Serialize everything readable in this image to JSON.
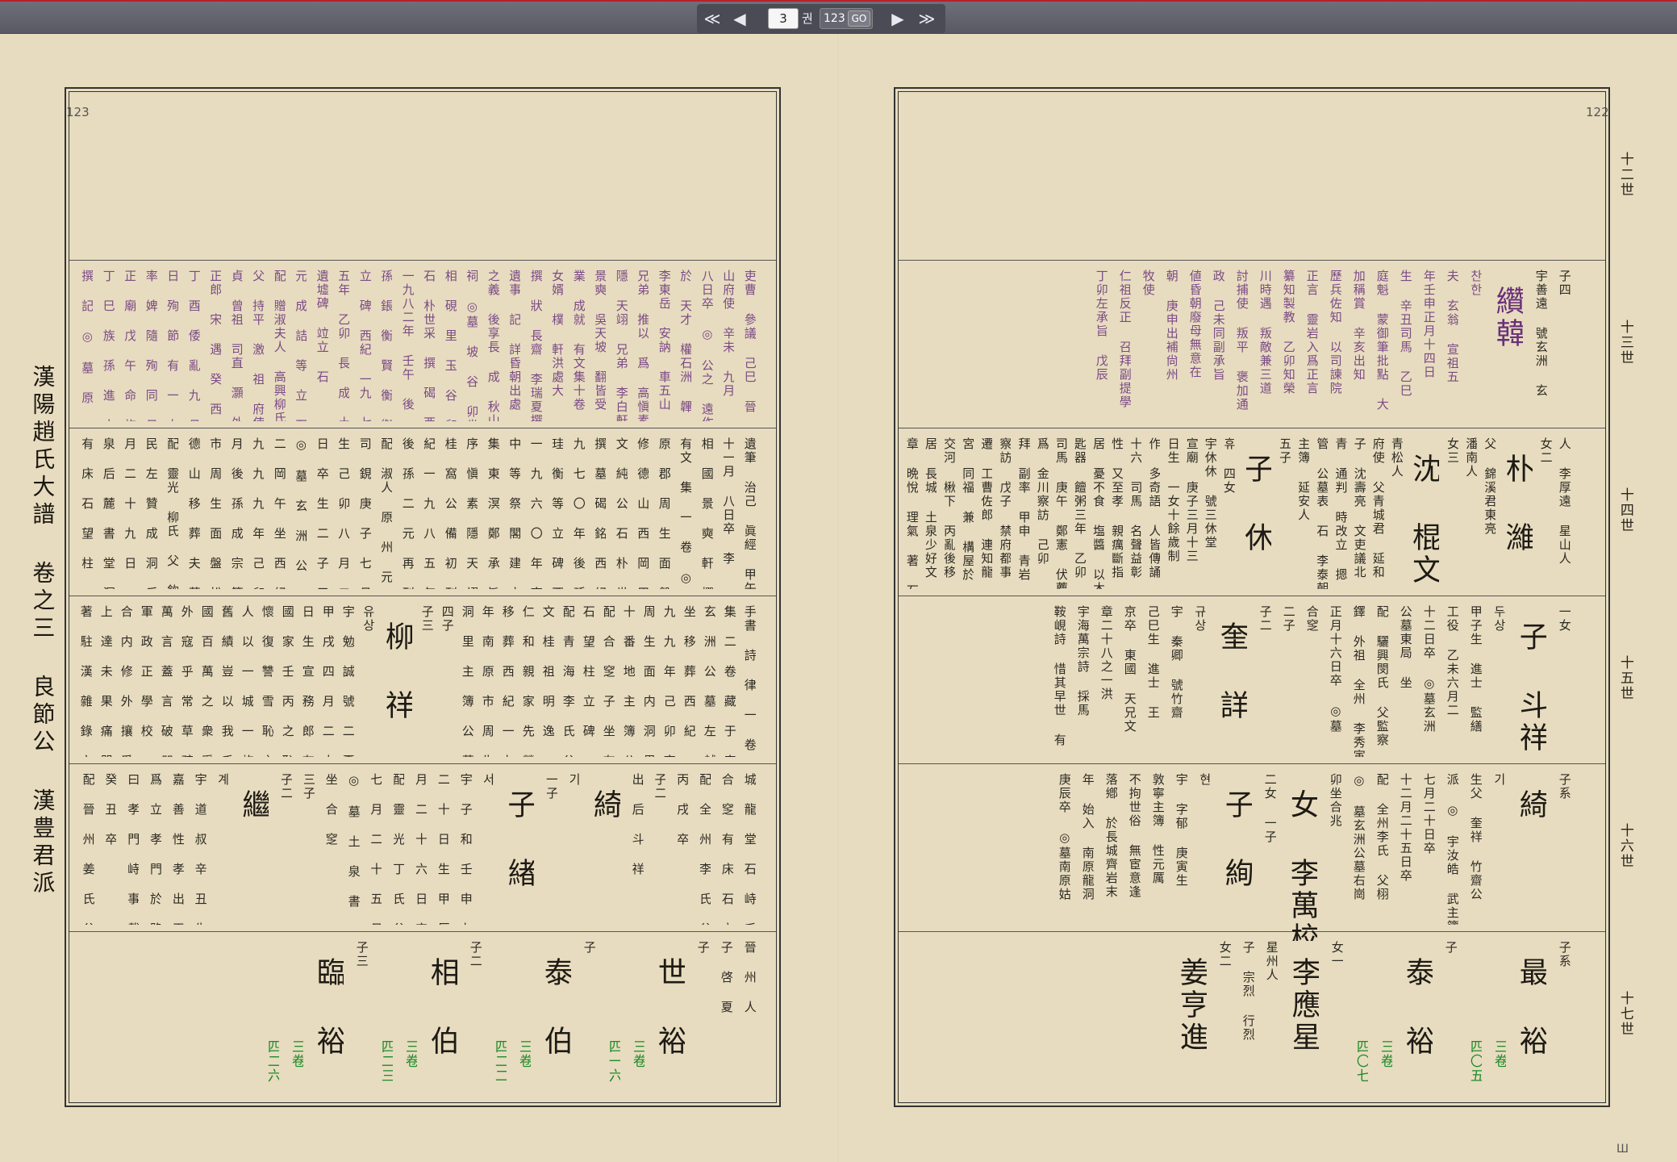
{
  "toolbar": {
    "first": "≪",
    "prev": "◀",
    "page": "3",
    "page_unit": "권",
    "total": "123",
    "go": "GO",
    "next": "▶",
    "last": "≫"
  },
  "pages": {
    "left_number": "123",
    "right_number": "122"
  },
  "book_title": "漢陽趙氏大譜 卷之三 良節公 漢豊君派",
  "generations": [
    "十二世",
    "十三世",
    "十四世",
    "十五世",
    "十六世",
    "十七世"
  ],
  "right_page": {
    "r13": [
      {
        "type": "s",
        "text": "子四"
      },
      {
        "type": "s",
        "text": "宇善遠 號玄洲 玄"
      },
      {
        "type": "bigp",
        "text": "纘韓"
      },
      {
        "type": "p",
        "text": "찬한"
      },
      {
        "type": "p",
        "text": "夫 玄翁 宣祖五"
      },
      {
        "type": "p",
        "text": "年壬申正月十四日"
      },
      {
        "type": "p",
        "text": "生 辛丑司馬 乙巳"
      },
      {
        "type": "p",
        "text": "庭魁 蒙御筆批點 大"
      },
      {
        "type": "p",
        "text": "加稱賞 辛亥出知"
      },
      {
        "type": "p",
        "text": "歷兵佐知 以司諫院"
      },
      {
        "type": "p",
        "text": "正言 靈岩入爲正言"
      },
      {
        "type": "p",
        "text": "纂知製教 乙卯知榮"
      },
      {
        "type": "p",
        "text": "川時遇 叛敵兼三道"
      },
      {
        "type": "p",
        "text": "討捕使 叛平 褒加通"
      },
      {
        "type": "p",
        "text": "政 己未同副承旨"
      },
      {
        "type": "p",
        "text": "値昏朝廢母無意在"
      },
      {
        "type": "p",
        "text": "朝 庚申出補尙州"
      },
      {
        "type": "p",
        "text": "牧使"
      },
      {
        "type": "p",
        "text": "仁祖反正 召拜副提學"
      },
      {
        "type": "p",
        "text": "丁卯左承旨 戊辰"
      }
    ],
    "r14": [
      {
        "type": "s",
        "text": "人 李厚遠 星山人"
      },
      {
        "type": "s",
        "text": "女二"
      },
      {
        "type": "big",
        "text": "朴 濰"
      },
      {
        "type": "s",
        "text": "父 錦溪君東亮"
      },
      {
        "type": "s",
        "text": "潘南人"
      },
      {
        "type": "s",
        "text": "女三"
      },
      {
        "type": "big",
        "text": "沈 棍文"
      },
      {
        "type": "s",
        "text": "青松人"
      },
      {
        "type": "s",
        "text": "府使 父青城君 延和"
      },
      {
        "type": "s",
        "text": "子 沈壽亮 文吏議北"
      },
      {
        "type": "s",
        "text": "青 通判 時改立 摁"
      },
      {
        "type": "s",
        "text": "管 公墓表 石 李泰朝"
      },
      {
        "type": "s",
        "text": "主簿 延安人"
      },
      {
        "type": "s",
        "text": "五子"
      },
      {
        "type": "big",
        "text": "子 休"
      },
      {
        "type": "s",
        "text": "휴 四女"
      },
      {
        "type": "s",
        "text": "宇休休 號三休堂"
      },
      {
        "type": "s",
        "text": "宣廟 庚子三月十三"
      },
      {
        "type": "s",
        "text": "日生 一女十餘歲制"
      },
      {
        "type": "s",
        "text": "作 多奇語 人皆傳誦"
      },
      {
        "type": "s",
        "text": "十六 司馬 名聲益彰"
      },
      {
        "type": "s",
        "text": "性 又至孝 親癘斷指"
      },
      {
        "type": "s",
        "text": "居 憂不食 塩醬 以木"
      },
      {
        "type": "s",
        "text": "匙器 饘粥三年 乙卯"
      },
      {
        "type": "s",
        "text": "司馬 庚午 鄭憲 伏薦"
      },
      {
        "type": "s",
        "text": "爲 金川察訪 己卯"
      },
      {
        "type": "s",
        "text": "拜 副率 甲申 青岩"
      },
      {
        "type": "s",
        "text": "察訪 戊子 禁府都事"
      },
      {
        "type": "s",
        "text": "遷 工曹佐郎 連知龍"
      },
      {
        "type": "s",
        "text": "宮 同福 兼 構屋於"
      },
      {
        "type": "s",
        "text": "交河 楸下 丙亂後移"
      },
      {
        "type": "s",
        "text": "居 長城 土泉少好文"
      },
      {
        "type": "s",
        "text": "章 晩悅 理氣 著 石硼"
      }
    ],
    "r15": [
      {
        "type": "s",
        "text": "一女"
      },
      {
        "type": "big",
        "text": "子 斗祥"
      },
      {
        "type": "s",
        "text": "두상"
      },
      {
        "type": "s",
        "text": "甲子生 進士 監繕"
      },
      {
        "type": "s",
        "text": "工役 乙未六月二"
      },
      {
        "type": "s",
        "text": "十二日卒 ◎墓玄洲"
      },
      {
        "type": "s",
        "text": "公墓東局 坐"
      },
      {
        "type": "s",
        "text": "配 驪興閔氏 父監察"
      },
      {
        "type": "s",
        "text": "鐸 外祖 全州 李秀寅"
      },
      {
        "type": "s",
        "text": "正月十六日卒 ◎墓"
      },
      {
        "type": "s",
        "text": "合窆"
      },
      {
        "type": "s",
        "text": "二子"
      },
      {
        "type": "s",
        "text": "子二"
      },
      {
        "type": "big",
        "text": "奎 詳"
      },
      {
        "type": "s",
        "text": "규상"
      },
      {
        "type": "s",
        "text": "宇 秦卿 號竹齋"
      },
      {
        "type": "s",
        "text": "己巳生 進士 王"
      },
      {
        "type": "s",
        "text": "京卒 東國 天兄文"
      },
      {
        "type": "s",
        "text": "章二十八之一洪"
      },
      {
        "type": "s",
        "text": "宇海萬宗詩 採馬"
      },
      {
        "type": "s",
        "text": "鞍峴詩 惜其早世 有"
      }
    ],
    "r16": [
      {
        "type": "s",
        "text": "子系"
      },
      {
        "type": "big",
        "text": "綺"
      },
      {
        "type": "s",
        "text": "기"
      },
      {
        "type": "s",
        "text": "生父 奎祥 竹齋公"
      },
      {
        "type": "s",
        "text": "派 ◎ 宇汝皓 武主簿"
      },
      {
        "type": "s",
        "text": "七月二十日卒"
      },
      {
        "type": "s",
        "text": "十二月二十五日卒"
      },
      {
        "type": "s",
        "text": "配 全州李氏 父栩"
      },
      {
        "type": "s",
        "text": "◎ 墓玄洲公墓右崗"
      },
      {
        "type": "s",
        "text": "卯坐合兆"
      },
      {
        "type": "big",
        "text": "女 李萬校"
      },
      {
        "type": "s",
        "text": "二女 一子"
      },
      {
        "type": "big",
        "text": "子 絢"
      },
      {
        "type": "s",
        "text": "현"
      },
      {
        "type": "s",
        "text": "宇 字郁 庚寅生"
      },
      {
        "type": "s",
        "text": "敦寧主簿 性元厲"
      },
      {
        "type": "s",
        "text": "不拘世俗 無宦意逢"
      },
      {
        "type": "s",
        "text": "落鄕 於長城齊岩末"
      },
      {
        "type": "s",
        "text": "年 始入 南原龍洞"
      },
      {
        "type": "s",
        "text": "庚辰卒 ◎墓南原姑"
      }
    ],
    "r17": [
      {
        "type": "s",
        "text": "子系"
      },
      {
        "type": "big",
        "text": "最 裕"
      },
      {
        "type": "g",
        "text": "三卷"
      },
      {
        "type": "g",
        "text": "四〇五"
      },
      {
        "type": "s",
        "text": "子"
      },
      {
        "type": "big",
        "text": "泰 裕"
      },
      {
        "type": "g",
        "text": "三卷"
      },
      {
        "type": "g",
        "text": "四〇七"
      },
      {
        "type": "s",
        "text": "女一"
      },
      {
        "type": "big",
        "text": "李應星"
      },
      {
        "type": "s",
        "text": "星州人"
      },
      {
        "type": "s",
        "text": "子 宗烈 行烈"
      },
      {
        "type": "s",
        "text": "女二"
      },
      {
        "type": "big",
        "text": "姜亨進"
      }
    ]
  },
  "left_page": {
    "r13": [
      {
        "type": "p",
        "text": "吏曹 參議 己巳 晉"
      },
      {
        "type": "p",
        "text": "山府使 辛未 九月"
      },
      {
        "type": "p",
        "text": "八日卒 ◎ 公之 遠作"
      },
      {
        "type": "p",
        "text": "於 天才 權石洲 韠"
      },
      {
        "type": "p",
        "text": "李東岳 安訥 車五山"
      },
      {
        "type": "p",
        "text": "兄弟 推以 爲 高愼素"
      },
      {
        "type": "p",
        "text": "隱 天翊 兄弟 李白軒"
      },
      {
        "type": "p",
        "text": "景奭 吳天坡 翻皆受"
      },
      {
        "type": "p",
        "text": "業 成就 有文集十卷"
      },
      {
        "type": "p",
        "text": "女婿 樸 軒洪處大"
      },
      {
        "type": "p",
        "text": "撰 狀 長齋 李瑞夏撰"
      },
      {
        "type": "p",
        "text": "遺事 記 詳昏朝出處"
      },
      {
        "type": "p",
        "text": "之義 後享長 成 秋山"
      },
      {
        "type": "p",
        "text": "祠 ◎墓 坡 谷 卯坐 玄"
      },
      {
        "type": "p",
        "text": "相 硯 里 玉 谷 卯坐 玄"
      },
      {
        "type": "p",
        "text": "石 朴世采 撰 碣 西紀"
      },
      {
        "type": "p",
        "text": "一九八二年 壬午 後"
      },
      {
        "type": "p",
        "text": "孫 鋹 衡 賢 衡 衡 等"
      },
      {
        "type": "p",
        "text": "立 碑 西紀 一九 七"
      },
      {
        "type": "p",
        "text": "五年 乙卯 長 成 土 泉"
      },
      {
        "type": "p",
        "text": "遺墟碑 竝立 石"
      },
      {
        "type": "p",
        "text": "元 成 詰 等 立 石"
      },
      {
        "type": "p",
        "text": "配 贈淑夫人 高興柳氏"
      },
      {
        "type": "p",
        "text": "父 持平 激 祖 府使 忠"
      },
      {
        "type": "p",
        "text": "貞 曾祖 司直 灝 外祖"
      },
      {
        "type": "p",
        "text": "正郎 宋 遇 癸 西 生 値"
      },
      {
        "type": "p",
        "text": "丁 酉 倭 亂 九 月 二 十"
      },
      {
        "type": "p",
        "text": "日 殉 節 有 一 女 先 夭"
      },
      {
        "type": "p",
        "text": "率 婢 隨 殉 同 日 並 死"
      },
      {
        "type": "p",
        "text": "正 廟 戊 午 命 旌 後 五"
      },
      {
        "type": "p",
        "text": "丁 巳 族 孫 進 士 一 元"
      },
      {
        "type": "p",
        "text": "撰 記 ◎ 墓 原 州 多 侍"
      }
    ],
    "r14": [
      {
        "type": "s",
        "text": "遺筆 治己 眞經 甲午"
      },
      {
        "type": "s",
        "text": "十一月 八日卒 李"
      },
      {
        "type": "s",
        "text": "相 國 景 奭 軒 撰 行 狀"
      },
      {
        "type": "s",
        "text": "有文 集 一 卷 ◎ 墓 南"
      },
      {
        "type": "s",
        "text": "原 郡 周 生 面 盤 松 里"
      },
      {
        "type": "s",
        "text": "修 德 山 西 岡 甲 坐"
      },
      {
        "type": "s",
        "text": "文 純 公 石 朴 世 采"
      },
      {
        "type": "s",
        "text": "撰 墓 碣 銘 西 紀 一"
      },
      {
        "type": "s",
        "text": "九 七 〇 年 後 孫 南 原"
      },
      {
        "type": "s",
        "text": "珪 衡 等 立 碑 西 紀"
      },
      {
        "type": "s",
        "text": "一 九 六 〇 年 南 原 門"
      },
      {
        "type": "s",
        "text": "中 等 祭 閣 建 立 有 文"
      },
      {
        "type": "s",
        "text": "集 東 溟 鄭 承 旨 斗 卿"
      },
      {
        "type": "s",
        "text": "序 愼 素 隱 天 翊 跋 弟"
      },
      {
        "type": "s",
        "text": "桂 窩 公 備 初 刊 西"
      },
      {
        "type": "s",
        "text": "紀 一 九 八 五 年 乙 丑"
      },
      {
        "type": "s",
        "text": "後 孫 二 元 再 刊"
      },
      {
        "type": "s",
        "text": "配 淑人 原 州 元 氏 父 監"
      },
      {
        "type": "s",
        "text": "司 鋧 庚 子 七 月 八 日"
      },
      {
        "type": "s",
        "text": "生 己 卯 八 月 二 十 二"
      },
      {
        "type": "s",
        "text": "日 卒 生 二 子 三 女"
      },
      {
        "type": "s",
        "text": "◎ 墓 玄 洲 公 墓 北 越"
      },
      {
        "type": "s",
        "text": "二 岡 午 坐 西 紀 一"
      },
      {
        "type": "s",
        "text": "九 九 九 年 己 卯 十 一"
      },
      {
        "type": "s",
        "text": "月 後 孫 成 宗 等 南 原"
      },
      {
        "type": "s",
        "text": "市 周 生 面 盤 松 里 修"
      },
      {
        "type": "s",
        "text": "德 山 移 葬 夫 墓 合 定"
      },
      {
        "type": "s",
        "text": "配 靈光 柳氏 父 欽 知 竟"
      },
      {
        "type": "s",
        "text": "民 左 贊 成 洞 后 忌 五"
      },
      {
        "type": "s",
        "text": "月 二 十 九 日 ◎ 墓 土"
      },
      {
        "type": "s",
        "text": "泉 后 麓 書 堂 洞 子 坐"
      },
      {
        "type": "s",
        "text": "有 床 石 望 柱 ◎ 生 三"
      }
    ],
    "r15": [
      {
        "type": "s",
        "text": "手書 詩 律 一 卷 有 文"
      },
      {
        "type": "s",
        "text": "集 二 卷 藏 于 家 ◎ 墓"
      },
      {
        "type": "s",
        "text": "玄 洲 公 墓 左 越 岡 寅"
      },
      {
        "type": "s",
        "text": "坐 移 葬 西 紀 一 九"
      },
      {
        "type": "s",
        "text": "九 九 年 己 卯 南 原 市"
      },
      {
        "type": "s",
        "text": "周 生 面 内 洞 里 山 三"
      },
      {
        "type": "s",
        "text": "十 番 地 主 簿 公 墓 左"
      },
      {
        "type": "s",
        "text": "配 合 窆 子 坐 有 床"
      },
      {
        "type": "s",
        "text": "石 望 柱 立 碑"
      },
      {
        "type": "s",
        "text": "配 青 海 李 氏 父 僉 正"
      },
      {
        "type": "s",
        "text": "文 桂 祖 明 逸 ◎ 墓 龍"
      },
      {
        "type": "s",
        "text": "仁 和 親 家 先 塋 内"
      },
      {
        "type": "s",
        "text": "移 葬 西 紀 一 九 五 八"
      },
      {
        "type": "s",
        "text": "年 南 原 市 周 生 面 内"
      },
      {
        "type": "s",
        "text": "洞 里 主 簿 公 墓 左 坐"
      },
      {
        "type": "s",
        "text": "四子"
      },
      {
        "type": "s",
        "text": "子三"
      },
      {
        "type": "big",
        "text": "柳 祥"
      },
      {
        "type": "s",
        "text": "유상"
      },
      {
        "type": "s",
        "text": "宇 勉 誠 號 二 憂 堂"
      },
      {
        "type": "s",
        "text": "甲 戌 四 月 二 十 四"
      },
      {
        "type": "s",
        "text": "日 生 宣 務 郎 有 文"
      },
      {
        "type": "s",
        "text": "國 家 壬 丙 之 恥 常"
      },
      {
        "type": "s",
        "text": "懷 復 讐 雪 恥 之 日 古"
      },
      {
        "type": "s",
        "text": "人 以 一 城 一 旅 能 復"
      },
      {
        "type": "s",
        "text": "舊 績 豈 以 我 千 乘 之"
      },
      {
        "type": "s",
        "text": "國 百 萬 之 衆 受 制 於"
      },
      {
        "type": "s",
        "text": "外 寇 乎 常 草 疏 十 餘"
      },
      {
        "type": "s",
        "text": "萬 言 蓋 言 破 朋 黨 修"
      },
      {
        "type": "s",
        "text": "軍 政 正 學 校 一 法"
      },
      {
        "type": "s",
        "text": "合 内 修 外 攘 爲 主 欽"
      },
      {
        "type": "s",
        "text": "上 達 未 果 痛 哭 而 歸"
      },
      {
        "type": "s",
        "text": "著 駐 漢 雜 錄 六 卷"
      }
    ],
    "r16": [
      {
        "type": "s",
        "text": "城 龍 堂 石 峙 壬 坐 配"
      },
      {
        "type": "s",
        "text": "合 窆 有 床 石 立 碑"
      },
      {
        "type": "s",
        "text": "配 全 州 李 氏 父 時 栽"
      },
      {
        "type": "s",
        "text": "丙 戌 卒"
      },
      {
        "type": "s",
        "text": "子二"
      },
      {
        "type": "s",
        "text": "出 后 斗 祥"
      },
      {
        "type": "big",
        "text": "綺"
      },
      {
        "type": "s",
        "text": "기"
      },
      {
        "type": "s",
        "text": "一子"
      },
      {
        "type": "big",
        "text": "子 緖"
      },
      {
        "type": "s",
        "text": "서"
      },
      {
        "type": "s",
        "text": "宇 子 和 壬 申 九 月"
      },
      {
        "type": "s",
        "text": "二 十 日 生 甲 辰 正"
      },
      {
        "type": "s",
        "text": "月 二 十 六 日 卒"
      },
      {
        "type": "s",
        "text": "配 靈 光 丁 氏 父 履 瑞"
      },
      {
        "type": "s",
        "text": "七 月 二 十 五 日 卒"
      },
      {
        "type": "s",
        "text": "◎ 墓 土 泉 書 堂 洞 寅"
      },
      {
        "type": "s",
        "text": "坐 合 窆"
      },
      {
        "type": "s",
        "text": "三子"
      },
      {
        "type": "s",
        "text": "子二"
      },
      {
        "type": "big",
        "text": "繼"
      },
      {
        "type": "s",
        "text": "계"
      },
      {
        "type": "s",
        "text": "宇 道 叔 辛 丑 生"
      },
      {
        "type": "s",
        "text": "嘉 善 性 孝 出 天 一 鄕"
      },
      {
        "type": "s",
        "text": "爲 立 孝 門 於 路 傍 名"
      },
      {
        "type": "s",
        "text": "曰 孝 門 峙 事 載 邑 誌"
      },
      {
        "type": "s",
        "text": "癸 丑 卒"
      },
      {
        "type": "s",
        "text": "配 晉 州 姜 氏 父 壽 瑞"
      }
    ],
    "r17": [
      {
        "type": "s",
        "text": "晉 州 人"
      },
      {
        "type": "s",
        "text": "子 啓 夏"
      },
      {
        "type": "s",
        "text": "子"
      },
      {
        "type": "big",
        "text": "世 裕"
      },
      {
        "type": "g",
        "text": "三卷"
      },
      {
        "type": "g",
        "text": "四一六"
      },
      {
        "type": "s",
        "text": "子"
      },
      {
        "type": "big",
        "text": "泰 伯"
      },
      {
        "type": "g",
        "text": "三卷"
      },
      {
        "type": "g",
        "text": "四二二"
      },
      {
        "type": "s",
        "text": "子二"
      },
      {
        "type": "big",
        "text": "相 伯"
      },
      {
        "type": "g",
        "text": "三卷"
      },
      {
        "type": "g",
        "text": "四二三"
      },
      {
        "type": "s",
        "text": "子三"
      },
      {
        "type": "big",
        "text": "臨 裕"
      },
      {
        "type": "g",
        "text": "三卷"
      },
      {
        "type": "g",
        "text": "四二六"
      }
    ]
  },
  "corner_mark": "Ш"
}
